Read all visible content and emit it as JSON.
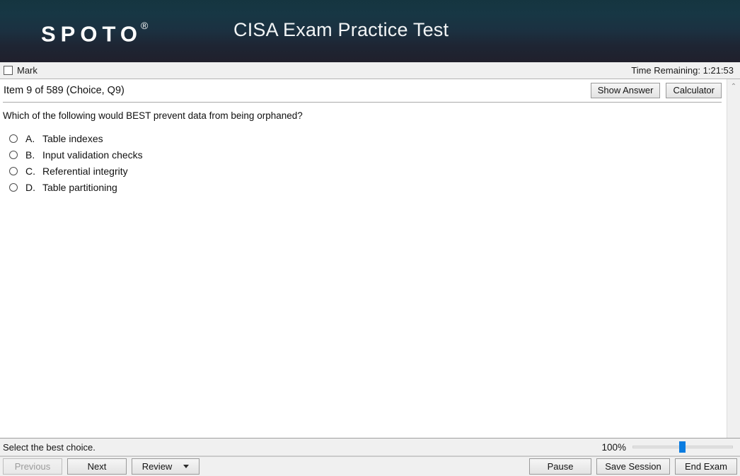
{
  "header": {
    "brand": "SPOTO",
    "brand_mark": "®",
    "title": "CISA Exam Practice Test"
  },
  "markbar": {
    "mark_label": "Mark",
    "timer_text": "Time Remaining: 1:21:53"
  },
  "item": {
    "label": "Item 9 of 589 (Choice, Q9)",
    "show_answer_label": "Show Answer",
    "calculator_label": "Calculator",
    "question": "Which of the following would BEST prevent data from being orphaned?",
    "options": [
      {
        "letter": "A.",
        "text": "Table indexes",
        "selected": false
      },
      {
        "letter": "B.",
        "text": "Input validation checks",
        "selected": false
      },
      {
        "letter": "C.",
        "text": "Referential integrity",
        "selected": false
      },
      {
        "letter": "D.",
        "text": "Table partitioning",
        "selected": false
      }
    ]
  },
  "status": {
    "hint": "Select the best choice.",
    "zoom_percent": "100%"
  },
  "toolbar": {
    "previous_label": "Previous",
    "next_label": "Next",
    "review_label": "Review",
    "pause_label": "Pause",
    "save_session_label": "Save Session",
    "end_exam_label": "End Exam"
  },
  "icons": {
    "scroll_up": "⌃"
  },
  "colors": {
    "banner_top": "#153540",
    "banner_bottom": "#20202c",
    "chrome": "#f0f0f0",
    "slider_thumb": "#0a7ce0",
    "text": "#111111"
  }
}
